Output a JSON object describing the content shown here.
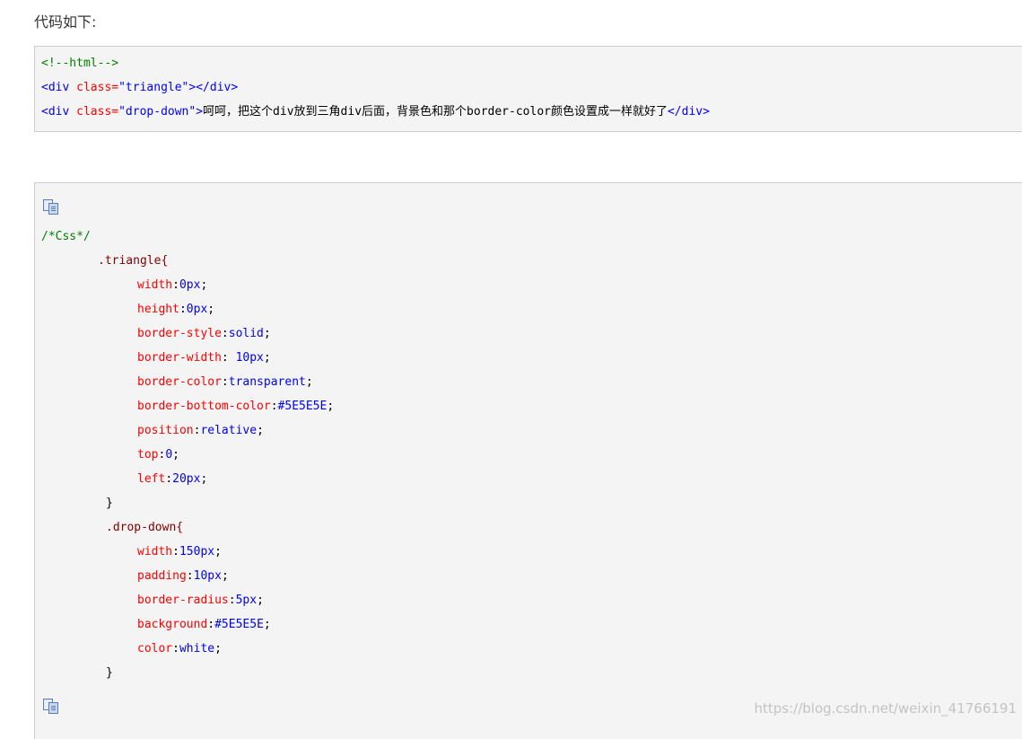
{
  "intro_text": "代码如下:",
  "html_block": {
    "line1_comment": "<!--html-->",
    "line2": {
      "open_tag": "<div",
      "attr": " class=",
      "value": "\"triangle\"",
      "close": "></div>"
    },
    "line3": {
      "open_tag": "<div",
      "attr": " class=",
      "value": "\"drop-down\"",
      "gt": ">",
      "text_a": "呵呵，把这个",
      "mono1": "div",
      "text_b": "放到三角",
      "mono2": "div",
      "text_c": "后面，背景色和那个",
      "mono3": "border-color",
      "text_d": "颜色设置成一样就好了",
      "close": "</div>"
    }
  },
  "css_block": {
    "comment": "/*Css*/",
    "triangle": {
      "selector": ".triangle{",
      "decls": [
        {
          "prop": "width",
          "val": "0px"
        },
        {
          "prop": "height",
          "val": "0px"
        },
        {
          "prop": "border-style",
          "val": "solid"
        },
        {
          "prop": "border-width",
          "val": " 10px"
        },
        {
          "prop": "border-color",
          "val": "transparent"
        },
        {
          "prop": "border-bottom-color",
          "val": "#5E5E5E"
        },
        {
          "prop": "position",
          "val": "relative"
        },
        {
          "prop": "top",
          "val": "0"
        },
        {
          "prop": "left",
          "val": "20px"
        }
      ],
      "close": "}"
    },
    "dropdown": {
      "selector": ".drop-down{",
      "decls": [
        {
          "prop": "width",
          "val": "150px"
        },
        {
          "prop": "padding",
          "val": "10px"
        },
        {
          "prop": "border-radius",
          "val": "5px"
        },
        {
          "prop": "background",
          "val": "#5E5E5E"
        },
        {
          "prop": "color",
          "val": "white"
        }
      ],
      "close": "}"
    }
  },
  "icons": {
    "copy_top": "copy-icon",
    "copy_bottom": "copy-icon"
  },
  "watermark": "https://blog.csdn.net/weixin_41766191"
}
